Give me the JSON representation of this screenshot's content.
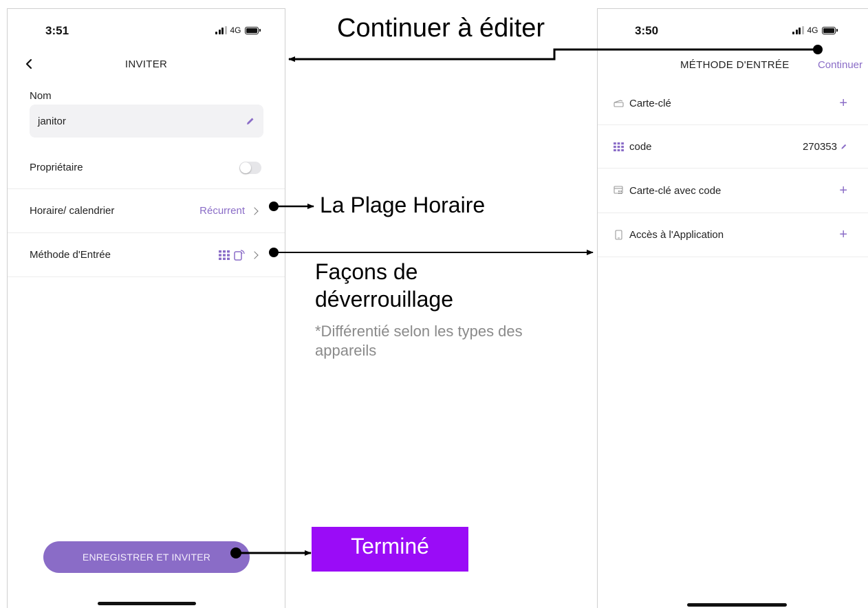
{
  "left_screen": {
    "status_time": "3:51",
    "network": "4G",
    "title": "INVITER",
    "name_label": "Nom",
    "name_value": "janitor",
    "owner_label": "Propriétaire",
    "schedule_label": "Horaire/ calendrier",
    "schedule_value": "Récurrent",
    "entry_label": "Méthode d'Entrée",
    "save_button": "ENREGISTRER ET INVITER"
  },
  "right_screen": {
    "status_time": "3:50",
    "network": "4G",
    "title": "MÉTHODE D'ENTRÉE",
    "continue_button": "Continuer",
    "items": [
      {
        "icon": "card-icon",
        "label": "Carte-clé",
        "action": "+"
      },
      {
        "icon": "keypad-icon",
        "label": "code",
        "value": "270353"
      },
      {
        "icon": "card-code-icon",
        "label": "Carte-clé avec code",
        "action": "+"
      },
      {
        "icon": "phone-icon",
        "label": "Accès à l'Application",
        "action": "+"
      }
    ]
  },
  "annotations": {
    "continue_edit": "Continuer à éditer",
    "time_range": "La Plage Horaire",
    "unlock_ways": "Façons de déverrouillage",
    "unlock_note": "*Différentié selon les types des appareils",
    "done": "Terminé"
  },
  "colors": {
    "accent": "#8a6cc7",
    "done_badge": "#9a0cf7",
    "note_text": "#8a8a8a"
  }
}
